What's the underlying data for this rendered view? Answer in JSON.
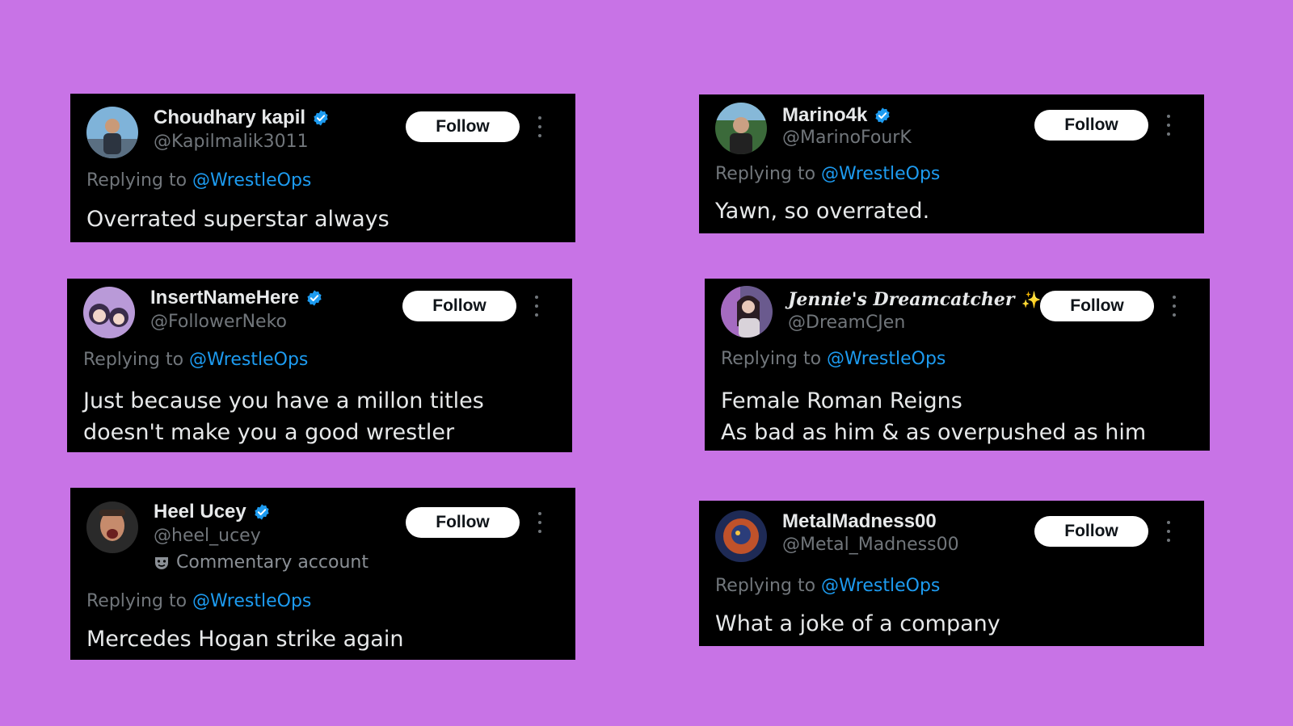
{
  "reply_prefix": "Replying to ",
  "follow_label": "Follow",
  "accent_color": "#1d9bf0",
  "cards": [
    {
      "name": "Choudhary kapil",
      "verified": true,
      "handle": "@Kapilmalik3011",
      "reply_to": "@WrestleOps",
      "text": "Overrated superstar always"
    },
    {
      "name": "Marino4k",
      "verified": true,
      "handle": "@MarinoFourK",
      "reply_to": "@WrestleOps",
      "text": "Yawn, so overrated."
    },
    {
      "name": "InsertNameHere",
      "verified": true,
      "handle": "@FollowerNeko",
      "reply_to": "@WrestleOps",
      "text": "Just because you have a millon titles\ndoesn't make you a good wrestler"
    },
    {
      "name": "Jennie's Dreamcatcher",
      "name_emoji": "✨",
      "verified": true,
      "handle": "@DreamCJen",
      "reply_to": "@WrestleOps",
      "text": "Female Roman Reigns\nAs bad as him & as overpushed as him"
    },
    {
      "name": "Heel Ucey",
      "verified": true,
      "handle": "@heel_ucey",
      "label": "Commentary account",
      "reply_to": "@WrestleOps",
      "text": "Mercedes Hogan strike again"
    },
    {
      "name": "MetalMadness00",
      "verified": false,
      "handle": "@Metal_Madness00",
      "reply_to": "@WrestleOps",
      "text": "What a joke of a company"
    }
  ]
}
